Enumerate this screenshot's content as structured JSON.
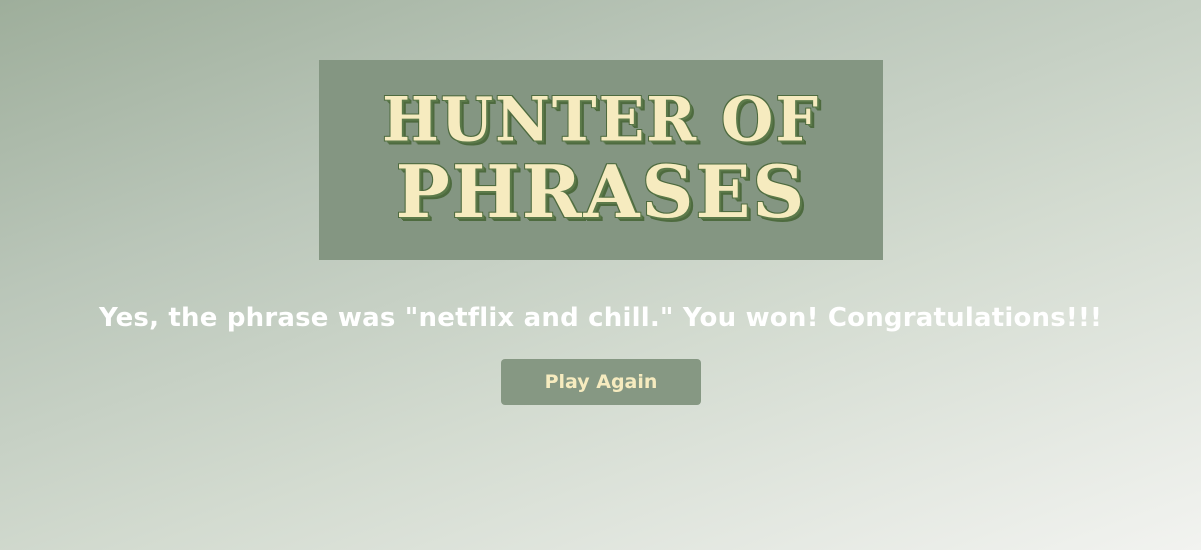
{
  "banner": {
    "title_line1": "HUNTER OF",
    "title_line2": "PHRASES"
  },
  "result": {
    "message": "Yes, the phrase was \"netflix and chill.\" You won! Congratulations!!!"
  },
  "actions": {
    "play_again_label": "Play Again"
  },
  "colors": {
    "banner_bg": "#849682",
    "title_fill": "#f6ebbf",
    "title_outline": "#4e6b3f",
    "button_bg": "#869883",
    "button_text": "#f6ebbf",
    "message_text": "#ffffff"
  }
}
